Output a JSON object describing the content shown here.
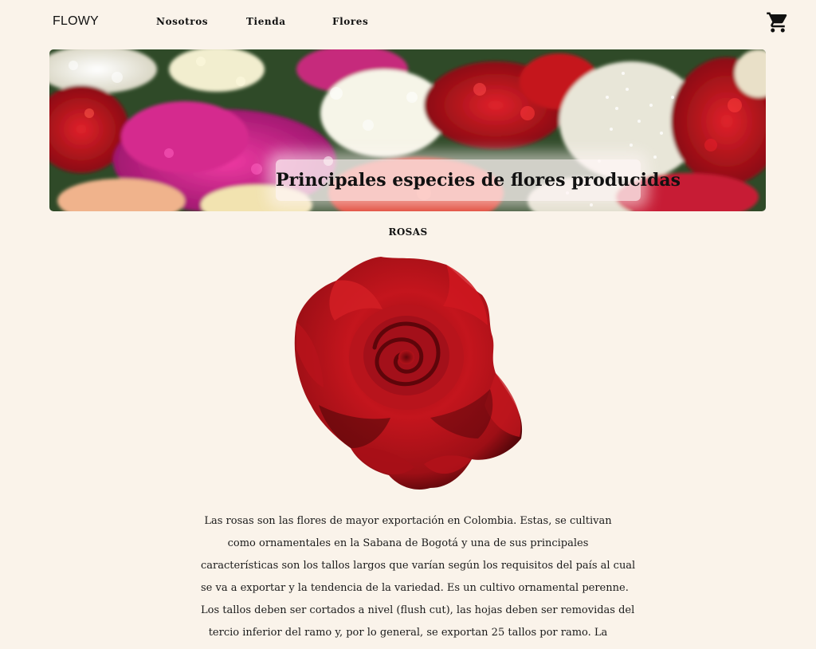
{
  "header": {
    "logo": "FLOWY",
    "nav": [
      {
        "label": "Nosotros"
      },
      {
        "label": "Tienda"
      },
      {
        "label": "Flores"
      }
    ],
    "cart_icon": "shopping-cart-icon"
  },
  "hero": {
    "title": "Principales especies de flores producidas",
    "image": "mixed-flowers-market-photo"
  },
  "section": {
    "title": "ROSAS",
    "image": "red-rose-photo",
    "description_lines": [
      "Las rosas son las flores de mayor exportación en Colombia. Estas, se cultivan",
      "como ornamentales en la Sabana de Bogotá y una de sus principales",
      "características son los tallos largos que varían según los requisitos del país al cual",
      "se va a exportar y la tendencia de la variedad. Es un cultivo ornamental perenne.",
      "Los tallos deben ser cortados a nivel (flush cut), las hojas deben ser removidas del",
      "tercio inferior del ramo y, por lo general, se exportan 25 tallos por ramo. La"
    ]
  },
  "colors": {
    "background": "#faf3ea",
    "rose_red": "#b3121a",
    "text": "#1a1a1a"
  }
}
